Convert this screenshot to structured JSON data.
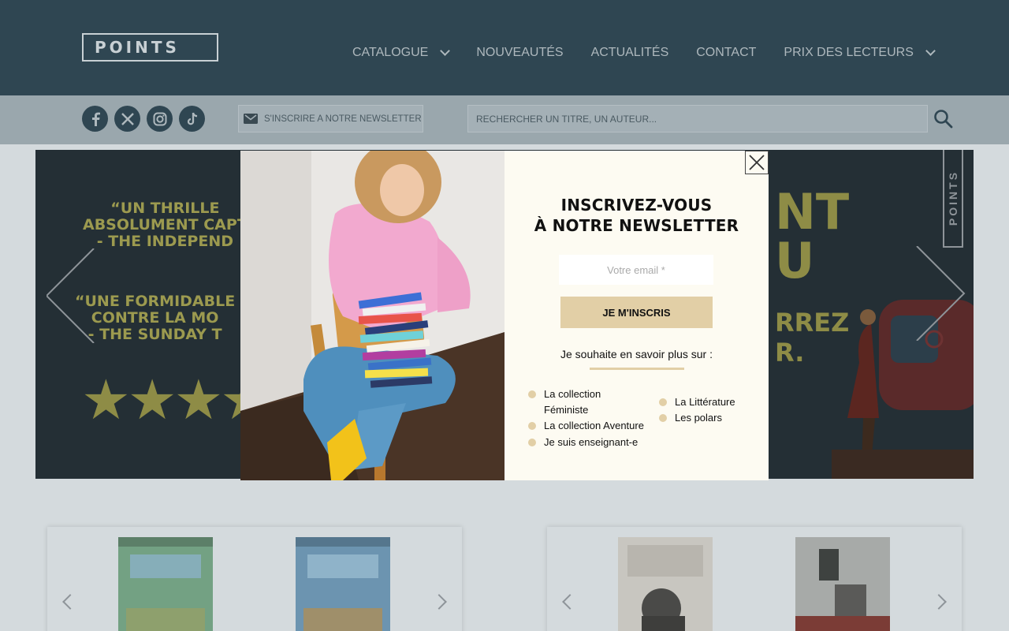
{
  "header": {
    "logo_text": "POINTS",
    "nav": [
      {
        "label": "CATALOGUE",
        "dropdown": true
      },
      {
        "label": "NOUVEAUTÉS",
        "dropdown": false
      },
      {
        "label": "ACTUALITÉS",
        "dropdown": false
      },
      {
        "label": "CONTACT",
        "dropdown": false
      },
      {
        "label": "PRIX DES LECTEURS",
        "dropdown": true
      }
    ]
  },
  "toolbar": {
    "social": [
      "facebook-icon",
      "x-icon",
      "instagram-icon",
      "tiktok-icon"
    ],
    "newsletter_label": "S'INSCRIRE A NOTRE NEWSLETTER",
    "search_placeholder": "RECHERCHER UN TITRE, UN AUTEUR..."
  },
  "banner": {
    "quote1_lines": [
      "“UN THRILLE",
      "ABSOLUMENT CAPT",
      "- THE INDEPEND"
    ],
    "quote2_lines": [
      "“UNE FORMIDABLE",
      "CONTRE LA MO",
      "- THE SUNDAY T"
    ],
    "right_title_lines": [
      "NT",
      "U"
    ],
    "right_sub_lines": [
      "RREZ",
      "R."
    ],
    "points_tab": "POINTS"
  },
  "modal": {
    "title_line1": "INSCRIVEZ-VOUS",
    "title_line2": "À NOTRE NEWSLETTER",
    "email_placeholder": "Votre email *",
    "submit_label": "JE M'INSCRIS",
    "more_label": "Je souhaite en savoir plus sur :",
    "options_left": [
      "La collection Féministe",
      "La collection Aventure",
      "Je suis enseignant-e"
    ],
    "options_right": [
      "La Littérature",
      "Les polars"
    ]
  },
  "colors": {
    "header_bg": "#2f4652",
    "accent_gold": "#e2cfa6",
    "modal_bg": "#fdfbf2"
  }
}
